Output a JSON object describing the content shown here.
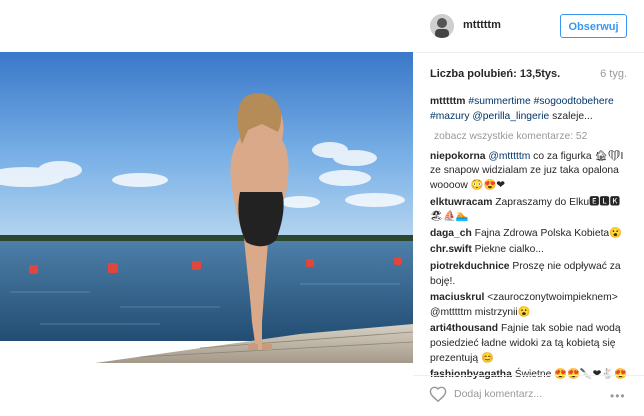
{
  "post": {
    "username": "mtttttm",
    "follow_label": "Obserwuj",
    "likes_label": "Liczba polubień: 13,5tys.",
    "time": "6 tyg.",
    "caption": {
      "user": "mtttttm",
      "tag1": "#summertime",
      "tag2": "#sogoodtobehere",
      "tag3": "#mazury",
      "mention": "@perilla_lingerie",
      "rest": "szaleje..."
    },
    "view_all": "zobacz wszystkie komentarze: 52",
    "comments": [
      {
        "user": "niepokorna",
        "mention": "@mtttttm",
        "text": "co za figurka 🏚❤I ze snapow widzialam ze juz taka opalona woooow 😳😍❤"
      },
      {
        "user": "elktuwracam",
        "mention": "",
        "text": "Zapraszamy do Elku🅴🅻🅺🏖⛵🏊"
      },
      {
        "user": "daga_ch",
        "mention": "",
        "text": "Fajna Zdrowa Polska Kobieta😮"
      },
      {
        "user": "chr.swift",
        "mention": "",
        "text": "Piekne cialko..."
      },
      {
        "user": "piotrekduchnice",
        "mention": "",
        "text": "Proszę nie odpływać za boję!."
      },
      {
        "user": "maciuskrul",
        "mention": "",
        "text": "<zauroczonytwoimpieknem> @mtttttm mistrzynii😮"
      },
      {
        "user": "arti4thousand",
        "mention": "",
        "text": "Fajnie tak sobie nad wodą posiedzieć ładne widoki za tą kobietą się prezentują 😊"
      },
      {
        "user": "fashionbyagatha",
        "mention": "",
        "text": "Świetne 😍😍🔪❤🐇😍"
      }
    ],
    "add_comment_placeholder": "Dodaj komentarz...",
    "more_label": "•••"
  },
  "icons": {
    "heart": "heart-icon",
    "more": "more-options-icon"
  },
  "colors": {
    "accent": "#3897f0",
    "hashtag": "#003569",
    "muted": "#999999"
  }
}
